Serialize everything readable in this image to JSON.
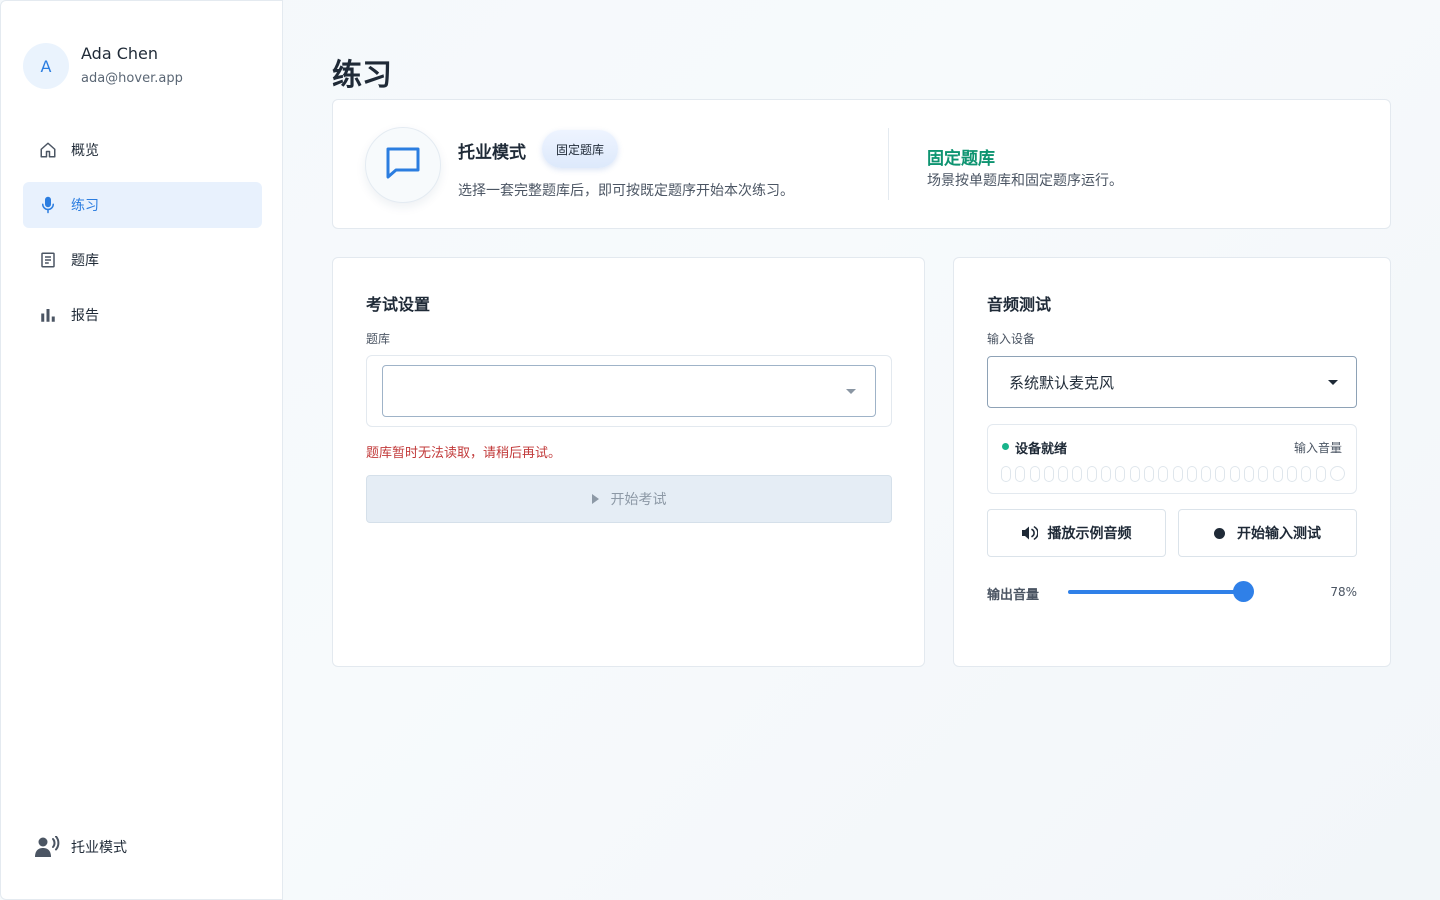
{
  "user": {
    "avatar_initial": "A",
    "name": "Ada Chen",
    "email": "ada@hover.app"
  },
  "nav": {
    "items": [
      {
        "label": "概览",
        "icon": "home-icon"
      },
      {
        "label": "练习",
        "icon": "microphone-icon",
        "active": true
      },
      {
        "label": "题库",
        "icon": "document-icon"
      },
      {
        "label": "报告",
        "icon": "bar-chart-icon"
      }
    ],
    "footer_label": "托业模式"
  },
  "page": {
    "title": "练习"
  },
  "mode": {
    "title": "托业模式",
    "badge": "固定题库",
    "description": "选择一套完整题库后，即可按既定题序开始本次练习。",
    "right_title": "固定题库",
    "right_description": "场景按单题库和固定题序运行。"
  },
  "exam": {
    "title": "考试设置",
    "bank_label": "题库",
    "bank_value": "",
    "error": "题库暂时无法读取，请稍后再试。",
    "start_label": "开始考试"
  },
  "audio": {
    "title": "音频测试",
    "device_label": "输入设备",
    "device_value": "系统默认麦克风",
    "status": "设备就绪",
    "input_level_label": "输入音量",
    "input_level": 0,
    "play_sample_label": "播放示例音频",
    "start_input_test_label": "开始输入测试",
    "output_label": "输出音量",
    "output_value": "78%",
    "output_level": 0.78
  },
  "colors": {
    "accent": "#2f80e8",
    "success": "#0e9471",
    "error": "#c23a3a"
  }
}
